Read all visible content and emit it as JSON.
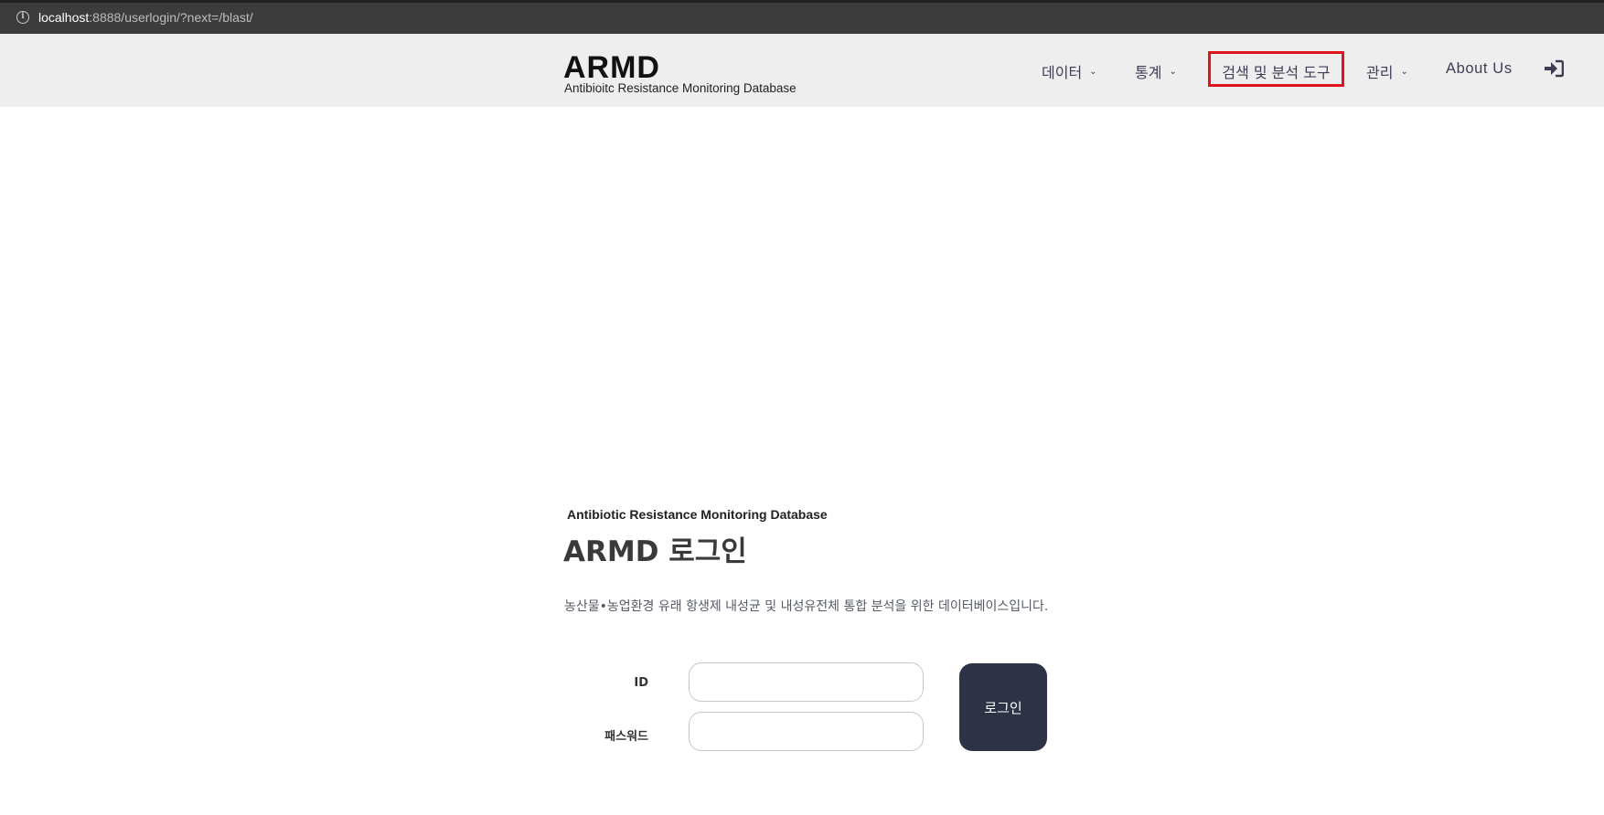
{
  "browser": {
    "url_host": "localhost",
    "url_rest": ":8888/userlogin/?next=/blast/"
  },
  "header": {
    "brand_title": "ARMD",
    "brand_subtitle": "Antibioitc Resistance Monitoring Database",
    "nav": {
      "data": "데이터",
      "stats": "통계",
      "search_tools": "검색 및 분석 도구",
      "admin": "관리",
      "about": "About Us"
    },
    "highlight_color": "#e1141c"
  },
  "login": {
    "db_subtitle": "Antibiotic Resistance Monitoring Database",
    "title": "ARMD 로그인",
    "description": "농산물•농업환경 유래 항생제 내성균 및 내성유전체 통합 분석을 위한 데이터베이스입니다.",
    "id_label": "ID",
    "password_label": "패스워드",
    "id_value": "",
    "password_value": "",
    "button_label": "로그인",
    "button_color": "#2e3246"
  },
  "icons": {
    "info": "info-icon",
    "chevron": "chevron-down-icon",
    "login": "sign-in-icon"
  }
}
